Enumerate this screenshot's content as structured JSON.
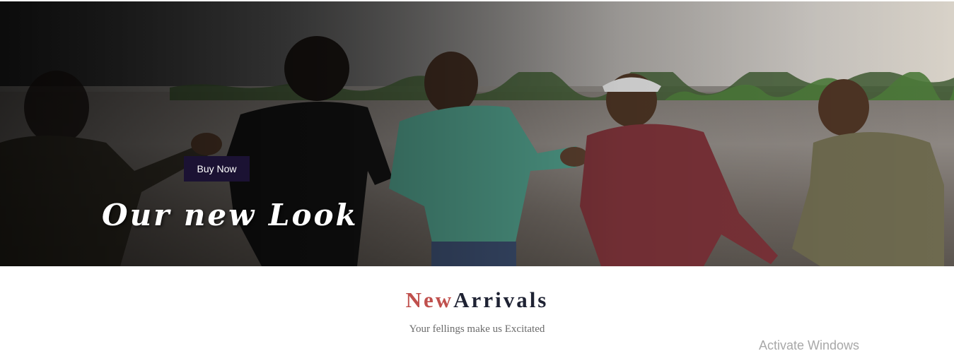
{
  "hero": {
    "button_label": "Buy Now",
    "title": "Our new Look"
  },
  "arrivals": {
    "title_accent": "New",
    "title_rest": "Arrivals",
    "subtitle": "Your fellings make us Excitated"
  },
  "watermark": "Activate Windows",
  "colors": {
    "button_bg": "#1b1233",
    "title_accent": "#c0504d",
    "title_dark": "#1e2233"
  }
}
